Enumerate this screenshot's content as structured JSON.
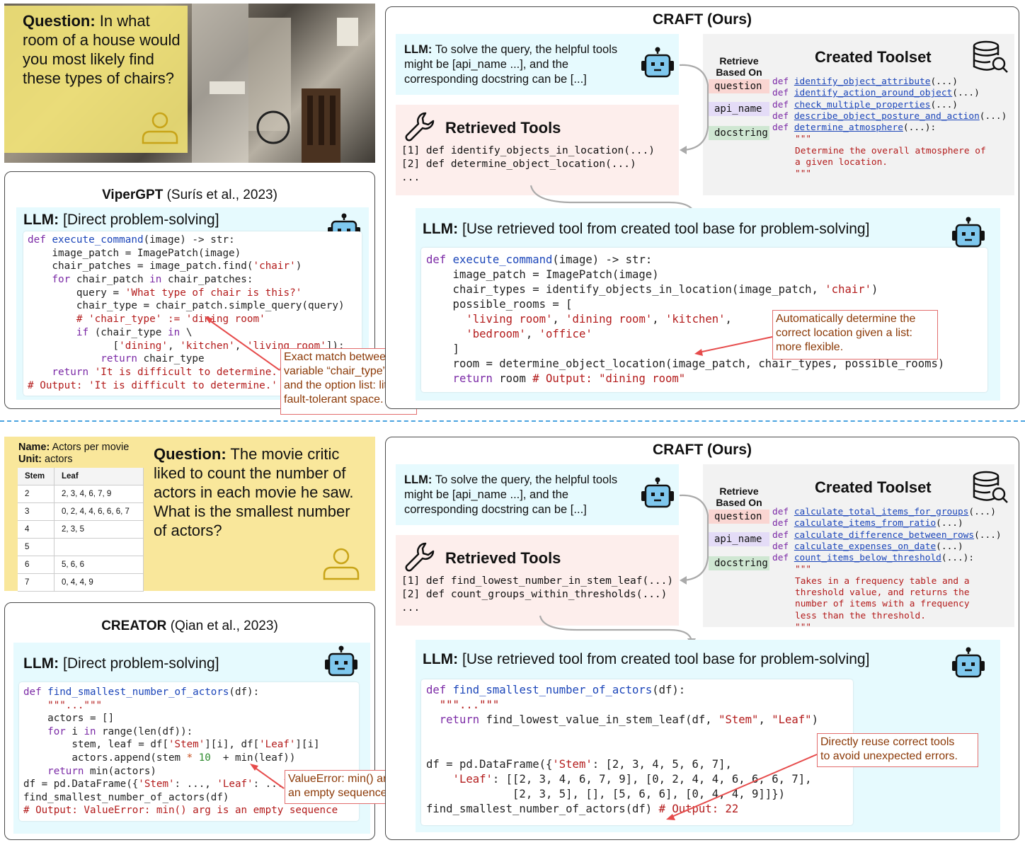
{
  "top": {
    "question_label": "Question:",
    "question_text": "In what room of a house would you most likely find these types of chairs?",
    "baseline": {
      "name": "ViperGPT",
      "cite": "(Surís et al., 2023)",
      "llm_label": "LLM:",
      "llm_text": "[Direct problem-solving]",
      "code": [
        [
          [
            "kw",
            "def "
          ],
          [
            "fn",
            "execute_command"
          ],
          [
            "",
            "(image) -> str:"
          ]
        ],
        [
          [
            "",
            "    image_patch = ImagePatch(image)"
          ]
        ],
        [
          [
            "",
            "    chair_patches = image_patch.find("
          ],
          [
            "st",
            "'chair'"
          ],
          [
            "",
            ")"
          ]
        ],
        [
          [
            "kw",
            "    for "
          ],
          [
            "",
            "chair_patch "
          ],
          [
            "kw",
            "in "
          ],
          [
            "",
            "chair_patches:"
          ]
        ],
        [
          [
            "",
            "        query = "
          ],
          [
            "st",
            "'What type of chair is this?'"
          ]
        ],
        [
          [
            "",
            "        chair_type = chair_patch.simple_query(query)"
          ]
        ],
        [
          [
            "cm",
            "        # 'chair_type' := 'dining room'"
          ]
        ],
        [
          [
            "kw",
            "        if "
          ],
          [
            "",
            "(chair_type "
          ],
          [
            "kw",
            "in "
          ],
          [
            "",
            "\\"
          ]
        ],
        [
          [
            "",
            "              ["
          ],
          [
            "st",
            "'dining'"
          ],
          [
            "",
            ", "
          ],
          [
            "st",
            "'kitchen'"
          ],
          [
            "",
            ", "
          ],
          [
            "st",
            "'living room'"
          ],
          [
            "",
            "]):"
          ]
        ],
        [
          [
            "kw",
            "            return "
          ],
          [
            "",
            "chair_type"
          ]
        ],
        [
          [
            "kw",
            "    return "
          ],
          [
            "st",
            "'It is difficult to determine.'"
          ]
        ],
        [
          [
            "cm",
            "# Output: 'It is difficult to determine.'"
          ]
        ]
      ],
      "callout": [
        "Exact match between",
        "variable “chair_type”",
        "and the option list: little",
        "fault-tolerant space."
      ]
    },
    "craft": {
      "title": "CRAFT (Ours)",
      "llm_label": "LLM:",
      "llm_text": [
        "To solve the query, the helpful tools",
        "might be [api_name ...], and the",
        "corresponding docstring can be [...]"
      ],
      "retrieved_title": "Retrieved Tools",
      "retrieved": [
        "[1] def identify_objects_in_location(...)",
        "[2] def determine_object_location(...)",
        "..."
      ],
      "retrieve_based_on": [
        "Retrieve",
        "Based On"
      ],
      "tags": [
        "question",
        "api_name",
        "docstring"
      ],
      "toolset_title": "Created Toolset",
      "toolset": [
        "identify_object_attribute",
        "identify_action_around_object",
        "check_multiple_properties",
        "describe_object_posture_and_action",
        "determine_atmosphere"
      ],
      "docstring": [
        "\"\"\"",
        "Determine the overall atmosphere of",
        "a given location.",
        "\"\"\""
      ],
      "solve_label": "LLM:",
      "solve_text": "[Use retrieved tool from created tool base for problem-solving]",
      "code": [
        [
          [
            "kw",
            "def "
          ],
          [
            "fn",
            "execute_command"
          ],
          [
            "",
            "(image) -> str:"
          ]
        ],
        [
          [
            "",
            "    image_patch = ImagePatch(image)"
          ]
        ],
        [
          [
            "",
            "    chair_types = identify_objects_in_location(image_patch, "
          ],
          [
            "st",
            "'chair'"
          ],
          [
            "",
            ")"
          ]
        ],
        [
          [
            "",
            "    possible_rooms = ["
          ]
        ],
        [
          [
            "st",
            "      'living room'"
          ],
          [
            "",
            ", "
          ],
          [
            "st",
            "'dining room'"
          ],
          [
            "",
            ", "
          ],
          [
            "st",
            "'kitchen'"
          ],
          [
            "",
            ","
          ]
        ],
        [
          [
            "st",
            "      'bedroom'"
          ],
          [
            "",
            ", "
          ],
          [
            "st",
            "'office'"
          ]
        ],
        [
          [
            "",
            "    ]"
          ]
        ],
        [
          [
            "",
            "    room = determine_object_location(image_patch, chair_types, possible_rooms)"
          ]
        ],
        [
          [
            "kw",
            "    return "
          ],
          [
            "",
            "room "
          ],
          [
            "cm",
            "# Output: \"dining room\""
          ]
        ]
      ],
      "callout": [
        "Automatically determine the",
        "correct location given a list:",
        "more flexible."
      ]
    }
  },
  "bottom": {
    "table_name_label": "Name:",
    "table_name": "Actors per movie",
    "table_unit_label": "Unit:",
    "table_unit": "actors",
    "table_headers": [
      "Stem",
      "Leaf"
    ],
    "table_rows": [
      [
        "2",
        "2, 3, 4, 6, 7, 9"
      ],
      [
        "3",
        "0, 2, 4, 4, 6, 6, 6, 7"
      ],
      [
        "4",
        "2, 3, 5"
      ],
      [
        "5",
        ""
      ],
      [
        "6",
        "5, 6, 6"
      ],
      [
        "7",
        "0, 4, 4, 9"
      ]
    ],
    "question_label": "Question:",
    "question_text": "The movie critic liked to count the number of actors in each movie he saw. What is the smallest number of actors?",
    "baseline": {
      "name": "CREATOR",
      "cite": "(Qian et al., 2023)",
      "llm_label": "LLM:",
      "llm_text": "[Direct problem-solving]",
      "code": [
        [
          [
            "kw",
            "def "
          ],
          [
            "fn",
            "find_smallest_number_of_actors"
          ],
          [
            "",
            "(df):"
          ]
        ],
        [
          [
            "st",
            "    \"\"\"...\"\"\""
          ]
        ],
        [
          [
            "",
            "    actors = []"
          ]
        ],
        [
          [
            "kw",
            "    for "
          ],
          [
            "",
            "i "
          ],
          [
            "kw",
            "in "
          ],
          [
            "",
            "range(len(df)):"
          ]
        ],
        [
          [
            "",
            "        stem, leaf = df["
          ],
          [
            "st",
            "'Stem'"
          ],
          [
            "",
            "][i], df["
          ],
          [
            "st",
            "'Leaf'"
          ],
          [
            "",
            "][i]"
          ]
        ],
        [
          [
            "",
            "        actors.append(stem "
          ],
          [
            "op",
            "*"
          ],
          [
            "",
            ""
          ],
          [
            "nm",
            " 10"
          ],
          [
            "",
            "  + min(leaf))"
          ]
        ],
        [
          [
            "kw",
            "    return "
          ],
          [
            "",
            "min(actors)"
          ]
        ],
        [
          [
            "",
            "df = pd.DataFrame({"
          ],
          [
            "st",
            "'Stem'"
          ],
          [
            "",
            ": ..., "
          ],
          [
            "st",
            "'Leaf'"
          ],
          [
            "",
            ": ...})"
          ]
        ],
        [
          [
            "",
            "find_smallest_number_of_actors(df)"
          ]
        ],
        [
          [
            "cm",
            "# Output: ValueError: min() arg is an empty sequence"
          ]
        ]
      ],
      "callout": [
        "ValueError: min() arg is",
        "an empty sequence"
      ]
    },
    "craft": {
      "title": "CRAFT (Ours)",
      "llm_label": "LLM:",
      "llm_text": [
        "To solve the query, the helpful tools",
        "might be [api_name ...], and the",
        "corresponding docstring can be [...]"
      ],
      "retrieved_title": "Retrieved Tools",
      "retrieved": [
        "[1] def find_lowest_number_in_stem_leaf(...)",
        "[2] def count_groups_within_thresholds(...)",
        "..."
      ],
      "retrieve_based_on": [
        "Retrieve",
        "Based On"
      ],
      "tags": [
        "question",
        "api_name",
        "docstring"
      ],
      "toolset_title": "Created Toolset",
      "toolset": [
        "calculate_total_items_for_groups",
        "calculate_items_from_ratio",
        "calculate_difference_between_rows",
        "calculate_expenses_on_date",
        "count_items_below_threshold"
      ],
      "docstring": [
        "\"\"\"",
        "Takes in a frequency table and a",
        "threshold value, and returns the",
        "number of items with a frequency",
        "less than the threshold.",
        "\"\"\""
      ],
      "solve_label": "LLM:",
      "solve_text": "[Use retrieved tool from created tool base for problem-solving]",
      "code": [
        [
          [
            "kw",
            "def "
          ],
          [
            "fn",
            "find_smallest_number_of_actors"
          ],
          [
            "",
            "(df):"
          ]
        ],
        [
          [
            "st",
            "  \"\"\"...\"\"\""
          ]
        ],
        [
          [
            "kw",
            "  return "
          ],
          [
            "",
            "find_lowest_value_in_stem_leaf(df, "
          ],
          [
            "st",
            "\"Stem\""
          ],
          [
            "",
            ", "
          ],
          [
            "st",
            "\"Leaf\""
          ],
          [
            "",
            ")"
          ]
        ],
        [
          [
            "",
            ""
          ]
        ],
        [
          [
            "",
            ""
          ]
        ],
        [
          [
            "",
            "df = pd.DataFrame({"
          ],
          [
            "st",
            "'Stem'"
          ],
          [
            "",
            ": [2, 3, 4, 5, 6, 7],"
          ]
        ],
        [
          [
            "st",
            "    'Leaf'"
          ],
          [
            "",
            ": [[2, 3, 4, 6, 7, 9], [0, 2, 4, 4, 6, 6, 6, 7],"
          ]
        ],
        [
          [
            "",
            "             [2, 3, 5], [], [5, 6, 6], [0, 4, 4, 9]]})"
          ]
        ],
        [
          [
            "",
            "find_smallest_number_of_actors(df) "
          ],
          [
            "cm",
            "# Output: 22"
          ]
        ]
      ],
      "callout": [
        "Directly reuse correct tools",
        "to avoid unexpected errors."
      ]
    }
  }
}
